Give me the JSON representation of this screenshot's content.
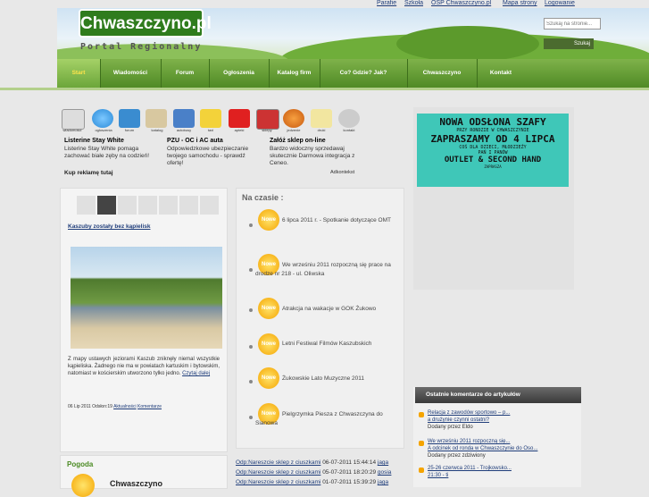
{
  "toplinks": [
    "Parafie",
    "Szkoła",
    "OSP Chwaszczyno.pl",
    "Mapa strony",
    "Logowanie"
  ],
  "logo": "Chwaszczyno.pl",
  "tagline": "Portal Regionalny",
  "search": {
    "placeholder": "Szukaj na stronie...",
    "button": "Szukaj"
  },
  "nav": [
    "Start",
    "Wiadomości",
    "Forum",
    "Ogłoszenia",
    "Katalog firm",
    "Co? Gdzie? Jak?",
    "Chwaszczyno",
    "Kontakt"
  ],
  "icons": [
    {
      "label": "wiadomości",
      "icon": "newspaper-icon"
    },
    {
      "label": "ogłoszenia",
      "icon": "speech-bubble-icon"
    },
    {
      "label": "forum",
      "icon": "chat-icon"
    },
    {
      "label": "katalog",
      "icon": "folder-icon"
    },
    {
      "label": "autobusy",
      "icon": "bus-icon"
    },
    {
      "label": "taxi",
      "icon": "taxi-icon"
    },
    {
      "label": "apteki",
      "icon": "pharmacy-icon"
    },
    {
      "label": "sklepy",
      "icon": "shop-icon"
    },
    {
      "label": "jedzenie",
      "icon": "food-icon"
    },
    {
      "label": "druki",
      "icon": "document-icon"
    },
    {
      "label": "kontakt",
      "icon": "contact-icon"
    }
  ],
  "ads": [
    {
      "title": "Listerine Stay White",
      "text": "Listerine Stay White pomaga zachować białe zęby na codzień!"
    },
    {
      "title": "PZU - OC i AC auta",
      "text": "Odpowiedzkowe ubezpieczanie twojego samochodu - sprawdź ofertę!"
    },
    {
      "title": "Załóż sklep on-line",
      "text": "Bardzo widoczny sprzedawaj skutecznie Darmowa integracja z Ceneo."
    }
  ],
  "ad_links": {
    "buy": "Kup reklamę tutaj",
    "provider": "Adkontekst"
  },
  "article": {
    "title": "Kaszuby zostały bez kąpielisk",
    "text": "Z mapy ustawych jeziorami Kaszub zniknęły niemal wszystkie kąpieliska. Żadnego nie ma w powiatach kartuskim i bytowskim, natomiast w kościerskim utworzono tylko jedno.",
    "more": "Czytaj dalej",
    "meta": "06 Lip 2011 Odsłon:19",
    "topics": "Aktualności",
    "comments": "Komentarze"
  },
  "weather": {
    "title": "Pogoda",
    "place": "Chwaszczyno"
  },
  "na_czasie": {
    "title": "Na czasie :",
    "badge": "Nowe",
    "items": [
      "6 lipca 2011 r. - Spotkanie dotyczące OMT",
      "We wrześniu 2011 rozpoczną się prace na drodze nr 218 - ul. Oliwska",
      "Atrakcja na wakacje w GOK Żukowo",
      "Letni Festiwal Filmów Kaszubskich",
      "Żukowskie Lato Muzyczne 2011",
      "Pielgrzymka Piesza z Chwaszczyna do Sianowa"
    ]
  },
  "forum_rows": [
    {
      "link": "Odp:Nareszcie sklep z ciuszkami",
      "date": "06-07-2011 15:44:14",
      "user": "jaga"
    },
    {
      "link": "Odp:Nareszcie sklep z ciuszkami",
      "date": "05-07-2011 18:20:29",
      "user": "gosia"
    },
    {
      "link": "Odp:Nareszcie sklep z ciuszkami",
      "date": "01-07-2011 15:39:29",
      "user": "jaga"
    }
  ],
  "banner": {
    "line1": "NOWA ODSŁONA SZAFY",
    "line2": "PRZY RONDZIE W CHWASZCZYNIE",
    "line3": "ZAPRASZAMY OD 4 LIPCA",
    "line4": "COŚ DLA DZIECI, MŁODZIEŻY",
    "line5": "PAŃ I PANÓW",
    "line6": "OUTLET & SECOND HAND",
    "line7": "ZAPRASZA"
  },
  "comments": {
    "title": "Ostatnie komentarze do artykułów",
    "items": [
      {
        "link": "Relacja z zawodów sportowo – p...",
        "sub": "a drużynie czynni ostatni?",
        "by": "Dodany przez Eldo"
      },
      {
        "link": "We wrześniu 2011 rozpoczną się...",
        "sub": "A odcinek od ronda w Chwaszczynie do Oso...",
        "by": "Dodany przez zdziwiony"
      },
      {
        "link": "25-26 czerwca 2011 - Trojkowsko...",
        "sub": "21:30 - ti",
        "by": ""
      }
    ]
  },
  "colors": {
    "nav_green": "#5a9630",
    "banner_teal": "#3fc7b8",
    "accent_orange": "#f5a400"
  }
}
